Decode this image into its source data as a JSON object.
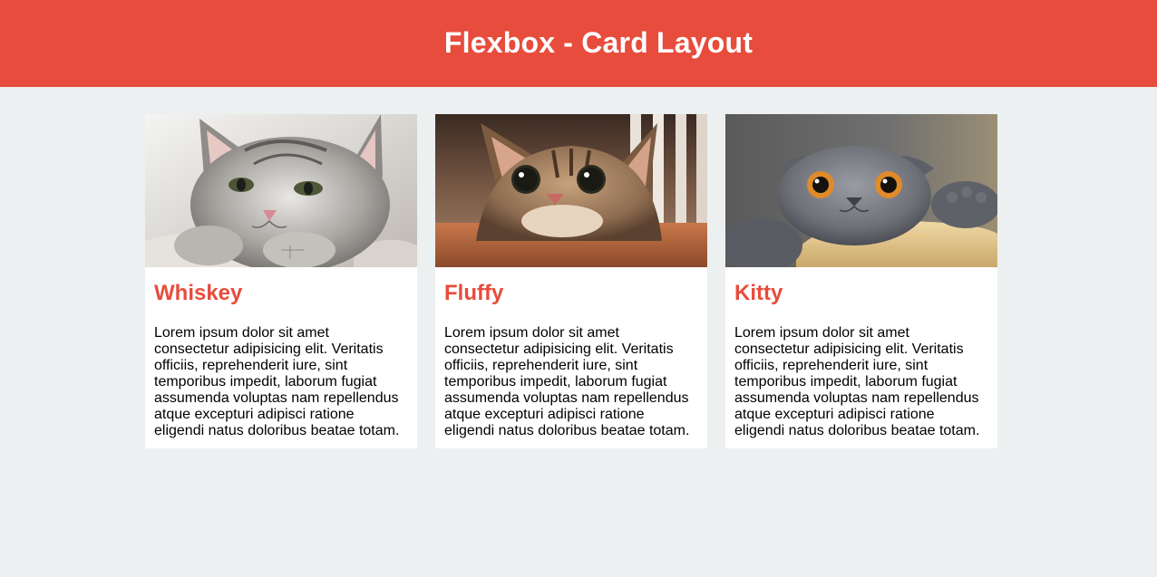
{
  "header": {
    "title": "Flexbox - Card Layout"
  },
  "colors": {
    "accent": "#e74c3c",
    "background": "#ecf0f1",
    "card": "#ffffff"
  },
  "cards": [
    {
      "title": "Whiskey",
      "image": "cat-photo-silver-kitten",
      "text": "Lorem ipsum dolor sit amet consectetur adipisicing elit. Veritatis officiis, reprehenderit iure, sint temporibus impedit, laborum fugiat assumenda voluptas nam repellendus atque excepturi adipisci ratione eligendi natus doloribus beatae totam."
    },
    {
      "title": "Fluffy",
      "image": "cat-photo-tabby-on-table",
      "text": "Lorem ipsum dolor sit amet consectetur adipisicing elit. Veritatis officiis, reprehenderit iure, sint temporibus impedit, laborum fugiat assumenda voluptas nam repellendus atque excepturi adipisci ratione eligendi natus doloribus beatae totam."
    },
    {
      "title": "Kitty",
      "image": "cat-photo-grey-scottish-fold",
      "text": "Lorem ipsum dolor sit amet consectetur adipisicing elit. Veritatis officiis, reprehenderit iure, sint temporibus impedit, laborum fugiat assumenda voluptas nam repellendus atque excepturi adipisci ratione eligendi natus doloribus beatae totam."
    }
  ]
}
